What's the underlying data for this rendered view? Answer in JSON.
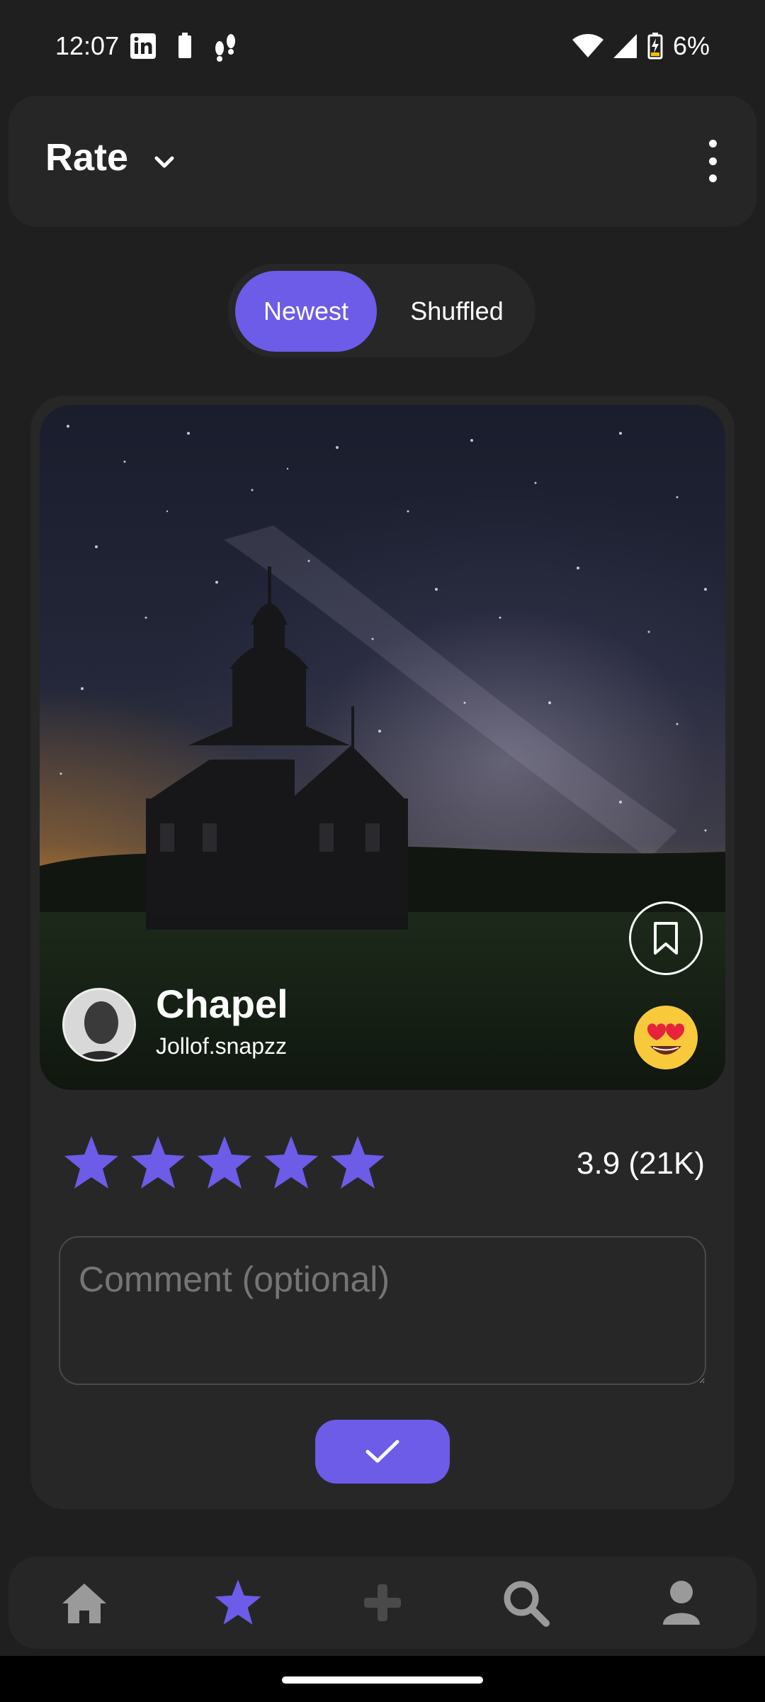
{
  "status_bar": {
    "time": "12:07",
    "battery_percent": "6%",
    "left_icons": [
      "linkedin-icon",
      "battery-saver-icon",
      "footsteps-icon"
    ],
    "right_icons": [
      "wifi-icon",
      "signal-icon",
      "battery-charging-icon"
    ]
  },
  "header": {
    "title": "Rate",
    "dropdown_icon": "chevron-down-icon",
    "menu_icon": "more-vert-icon"
  },
  "feed_toggle": {
    "options": [
      "Newest",
      "Shuffled"
    ],
    "selected": "Newest"
  },
  "post": {
    "title": "Chapel",
    "author": "Jollof.snapzz",
    "reaction_emoji": "😍",
    "bookmark_icon": "bookmark-icon",
    "rating": {
      "stars_total": 5,
      "stars_filled": 5,
      "summary": "3.9 (21K)"
    }
  },
  "comment": {
    "placeholder": "Comment (optional)",
    "value": ""
  },
  "submit": {
    "icon": "check-icon"
  },
  "bottom_nav": {
    "items": [
      {
        "icon": "home-icon",
        "active": false
      },
      {
        "icon": "star-icon",
        "active": true
      },
      {
        "icon": "plus-icon",
        "active": false
      },
      {
        "icon": "search-icon",
        "active": false
      },
      {
        "icon": "person-icon",
        "active": false
      }
    ]
  },
  "colors": {
    "background": "#1f1f1f",
    "surface": "#262626",
    "accent": "#6c5ce7",
    "nav_inactive": "#9a9a9a"
  }
}
